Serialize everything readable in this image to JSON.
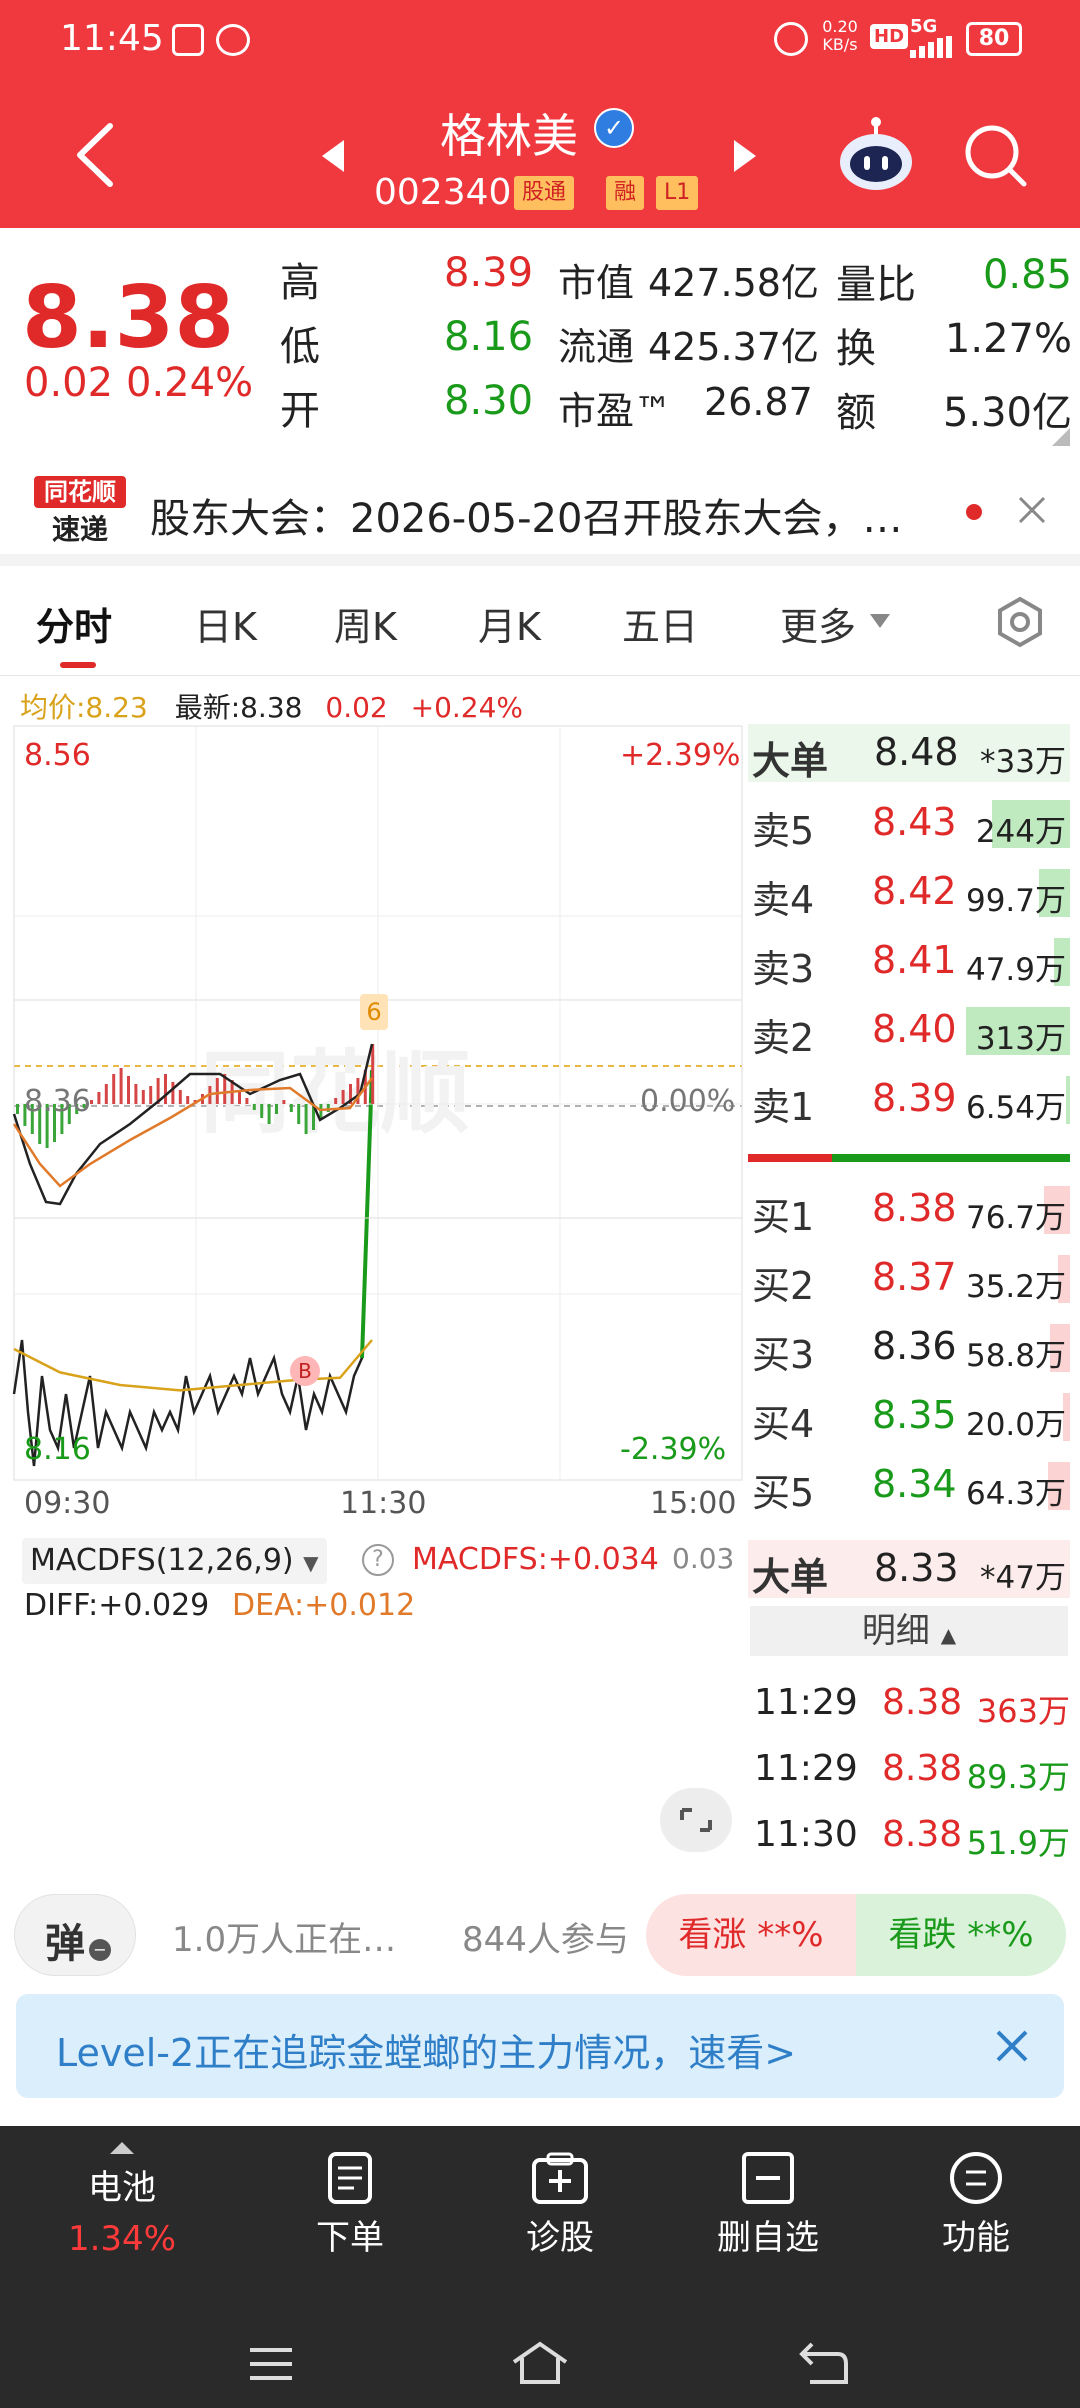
{
  "status_bar": {
    "time": "11:45",
    "net_speed_top": "0.20",
    "net_speed_unit": "KB/s",
    "hd": "HD",
    "signal": "5G",
    "battery": "80"
  },
  "header": {
    "stock_name": "格林美",
    "stock_code": "002340",
    "tag_connect": "股通",
    "tag_margin": "融",
    "tag_level": "L1"
  },
  "quote": {
    "price": "8.38",
    "change": "0.02",
    "change_pct": "0.24%",
    "high_label": "高",
    "high": "8.39",
    "low_label": "低",
    "low": "8.16",
    "open_label": "开",
    "open": "8.30",
    "mktcap_label": "市值",
    "mktcap": "427.58亿",
    "float_label": "流通",
    "float": "425.37亿",
    "pe_label": "市盈™",
    "pe": "26.87",
    "volratio_label": "量比",
    "volratio": "0.85",
    "turnover_label": "换",
    "turnover": "1.27%",
    "amount_label": "额",
    "amount": "5.30亿"
  },
  "news": {
    "logo_top": "同花顺",
    "logo_bottom": "速递",
    "text": "股东大会：2026-05-20召开股东大会，…"
  },
  "tabs": [
    {
      "label": "分时"
    },
    {
      "label": "日K"
    },
    {
      "label": "周K"
    },
    {
      "label": "月K"
    },
    {
      "label": "五日"
    },
    {
      "label": "更多"
    }
  ],
  "intraday": {
    "avg_label": "均价:8.23",
    "latest_label": "最新:8.38",
    "chg": "0.02",
    "chg_pct": "+0.24%",
    "y_top": "8.56",
    "y_top_pct": "+2.39%",
    "y_mid": "8.36",
    "y_mid_pct": "0.00%",
    "y_bot": "8.16",
    "y_bot_pct": "-2.39%",
    "t_start": "09:30",
    "t_mid": "11:30",
    "t_end": "15:00",
    "marker": "6",
    "marker_b": "B"
  },
  "macd": {
    "title": "MACDFS(12,26,9)",
    "macd_val": "MACDFS:+0.034",
    "right_val": "0.03",
    "diff": "DIFF:+0.029",
    "dea": "DEA:+0.012"
  },
  "order_book": {
    "big_top_label": "大单",
    "big_top_price": "8.48",
    "big_top_vol": "*33万",
    "asks": [
      {
        "label": "卖5",
        "price": "8.43",
        "vol": "244万",
        "fill": 0.75
      },
      {
        "label": "卖4",
        "price": "8.42",
        "vol": "99.7万",
        "fill": 0.3
      },
      {
        "label": "卖3",
        "price": "8.41",
        "vol": "47.9万",
        "fill": 0.15
      },
      {
        "label": "卖2",
        "price": "8.40",
        "vol": "313万",
        "fill": 1.0
      },
      {
        "label": "卖1",
        "price": "8.39",
        "vol": "6.54万",
        "fill": 0.03
      }
    ],
    "bids": [
      {
        "label": "买1",
        "price": "8.38",
        "vol": "76.7万",
        "fill": 0.25
      },
      {
        "label": "买2",
        "price": "8.37",
        "vol": "35.2万",
        "fill": 0.12
      },
      {
        "label": "买3",
        "price": "8.36",
        "vol": "58.8万",
        "fill": 0.19
      },
      {
        "label": "买4",
        "price": "8.35",
        "vol": "20.0万",
        "fill": 0.07
      },
      {
        "label": "买5",
        "price": "8.34",
        "vol": "64.3万",
        "fill": 0.21
      }
    ],
    "big_bot_label": "大单",
    "big_bot_price": "8.33",
    "big_bot_vol": "*47万",
    "detail_label": "明细",
    "ticks": [
      {
        "time": "11:29",
        "price": "8.38",
        "vol": "363万"
      },
      {
        "time": "11:29",
        "price": "8.38",
        "vol": "89.3万"
      },
      {
        "time": "11:30",
        "price": "8.38",
        "vol": "51.9万"
      }
    ]
  },
  "poll": {
    "danmu": "弹",
    "watching": "1.0万人正在…",
    "participants": "844人参与",
    "up_label": "看涨 **%",
    "down_label": "看跌 **%"
  },
  "banner": {
    "text": "Level-2正在追踪金螳螂的主力情况，速看>"
  },
  "bottom_nav": {
    "battery_label": "电池",
    "battery_pct": "1.34%",
    "order_label": "下单",
    "diagnose_label": "诊股",
    "remove_label": "删自选",
    "function_label": "功能"
  },
  "colors": {
    "header_red": "#f0383f",
    "up_red": "#e02a2a",
    "down_green": "#1a9a1a",
    "avg_yellow": "#d9a21b",
    "banner_blue": "#2e7ec8"
  }
}
